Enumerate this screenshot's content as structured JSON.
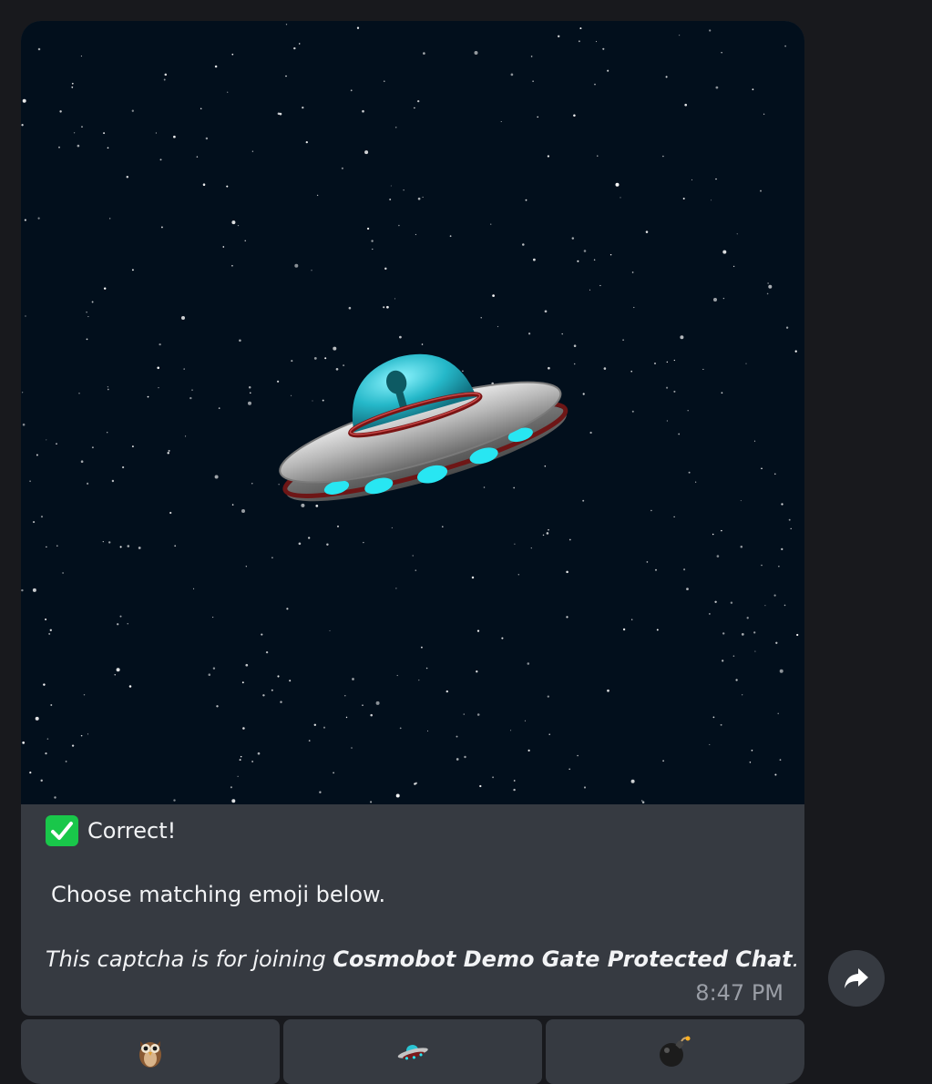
{
  "message": {
    "image": {
      "subject_icon": "flying-saucer-icon"
    },
    "status_icon": "check-mark-button-icon",
    "status_text": "Correct!",
    "instruction": "Choose matching emoji below.",
    "note_prefix": "This captcha is for joining ",
    "note_chat_name": "Cosmobot Demo Gate Protected Chat",
    "note_suffix": ".",
    "time": "8:47 PM"
  },
  "keyboard": {
    "buttons": [
      {
        "icon": "owl-icon"
      },
      {
        "icon": "flying-saucer-icon"
      },
      {
        "icon": "bomb-icon"
      }
    ]
  },
  "forward_button": {
    "icon": "forward-arrow-icon"
  },
  "colors": {
    "background": "#18191d",
    "bubble": "#363a41",
    "space": "#020f1c",
    "check_green": "#19c74a",
    "time_text": "#9a9ea6"
  }
}
